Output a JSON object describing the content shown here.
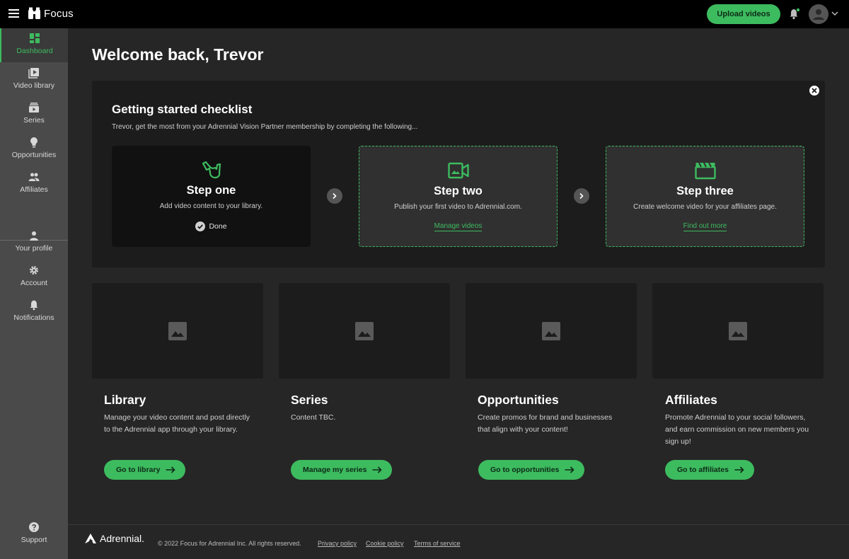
{
  "app": {
    "name": "Focus"
  },
  "topbar": {
    "upload_label": "Upload videos",
    "accent": "#3dbb5f"
  },
  "sidebar": {
    "items": [
      {
        "label": "Dashboard",
        "icon": "dashboard-icon",
        "active": true
      },
      {
        "label": "Video library",
        "icon": "video-library-icon"
      },
      {
        "label": "Series",
        "icon": "series-icon"
      },
      {
        "label": "Opportunities",
        "icon": "lightbulb-icon"
      },
      {
        "label": "Affiliates",
        "icon": "people-icon"
      },
      {
        "label": "Your profile",
        "icon": "person-icon"
      },
      {
        "label": "Account",
        "icon": "gear-icon"
      },
      {
        "label": "Notifications",
        "icon": "bell-icon"
      },
      {
        "label": "Support",
        "icon": "help-icon"
      }
    ]
  },
  "main": {
    "title": "Welcome back, Trevor"
  },
  "checklist": {
    "title": "Getting started checklist",
    "subtitle": "Trevor, get the most from your Adrennial Vision Partner membership by completing the following...",
    "steps": [
      {
        "name": "Step one",
        "desc": "Add video content to your library.",
        "status": "Done",
        "icon": "shaka-hand-icon"
      },
      {
        "name": "Step two",
        "desc": "Publish your first video to Adrennial.com.",
        "link": "Manage videos",
        "icon": "video-camera-icon"
      },
      {
        "name": "Step three",
        "desc": "Create welcome video for your affiliates page.",
        "link": "Find out more",
        "icon": "clapperboard-icon"
      }
    ]
  },
  "cards": [
    {
      "title": "Library",
      "desc": "Manage your video content and post directly to the Adrennial app through your library.",
      "button": "Go to library"
    },
    {
      "title": "Series",
      "desc": "Content TBC.",
      "button": "Manage my series"
    },
    {
      "title": "Opportunities",
      "desc": "Create promos for brand and businesses that align with your content!",
      "button": "Go to opportunities"
    },
    {
      "title": "Affiliates",
      "desc": "Promote Adrennial to your social followers, and earn commission on new members you sign up!",
      "button": "Go to affiliates"
    }
  ],
  "footer": {
    "brand": "Adrennial.",
    "copyright": "© 2022 Focus for Adrennial Inc. All rights reserved.",
    "links": [
      "Privacy policy",
      "Cookie policy",
      "Terms of service"
    ]
  }
}
